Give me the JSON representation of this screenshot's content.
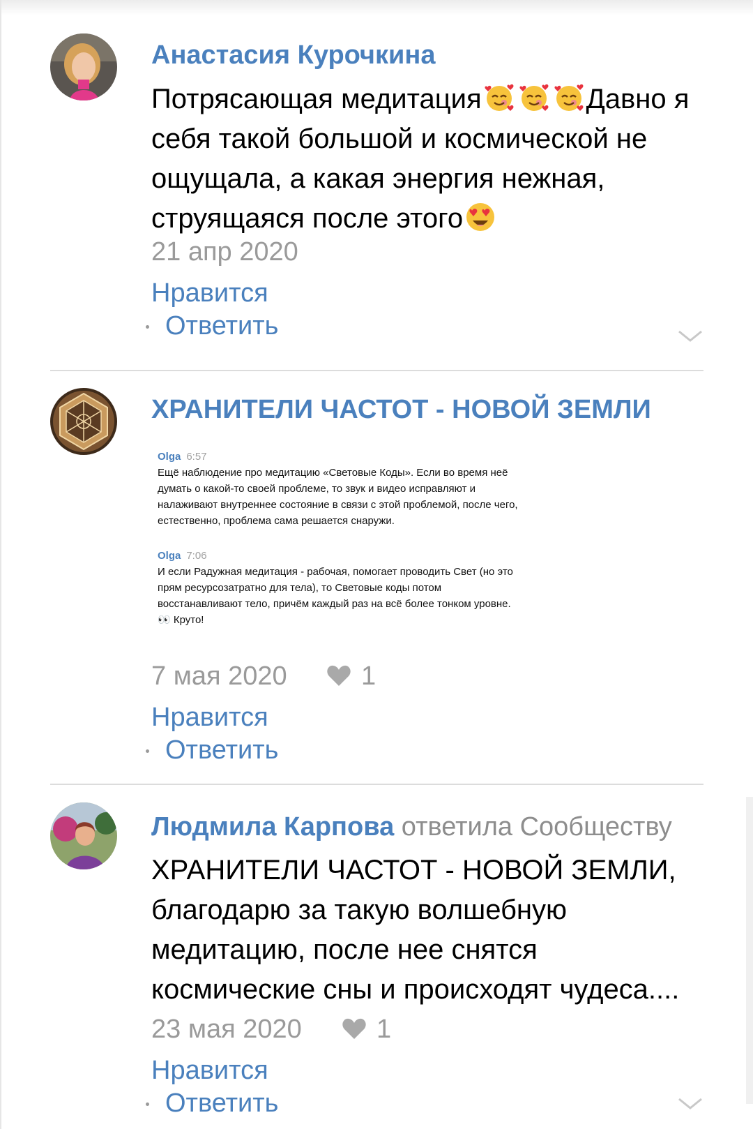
{
  "comments": [
    {
      "author": "Анастасия Курочкина",
      "text_before": "Потрясающая медитация",
      "text_after": "Давно я себя такой большой и космической не ощущала, а какая энергия нежная, струящаяся после этого",
      "emoji_icons": [
        "smiling-face-with-hearts-icon",
        "smiling-face-with-hearts-icon",
        "smiling-face-with-hearts-icon",
        "heart-eyes-icon"
      ],
      "date": "21 апр 2020",
      "like_label": "Нравится",
      "reply_label": "Ответить"
    },
    {
      "author": "ХРАНИТЕЛИ ЧАСТОТ - НОВОЙ ЗЕМЛИ",
      "attachment": {
        "messages": [
          {
            "name": "Olga",
            "time": "6:57",
            "text": "Ещё наблюдение про медитацию «Световые Коды». Если во время неё думать о какой-то своей проблеме, то звук и видео исправляют и налаживают внутреннее состояние в связи с этой проблемой, после чего, естественно, проблема сама решается снаружи."
          },
          {
            "name": "Olga",
            "time": "7:06",
            "text": "И если Радужная медитация - рабочая, помогает проводить Свет (но это прям ресурсозатратно для тела), то Световые коды потом восстанавливают тело, причём каждый раз на всё более тонком уровне. 👀 Круто!"
          }
        ]
      },
      "date": "7 мая 2020",
      "likes": "1",
      "like_label": "Нравится",
      "reply_label": "Ответить"
    },
    {
      "author": "Людмила Карпова",
      "author_suffix": "ответила Сообществу",
      "text": "ХРАНИТЕЛИ ЧАСТОТ - НОВОЙ ЗЕМЛИ, благодарю за такую волшебную медитацию, после нее снятся космические сны и происходят чудеса....",
      "date": "23 мая 2020",
      "likes": "1",
      "like_label": "Нравится",
      "reply_label": "Ответить"
    }
  ],
  "colors": {
    "link": "#4a80bd",
    "meta": "#9a9a9a",
    "divider": "#dcdcdc"
  }
}
